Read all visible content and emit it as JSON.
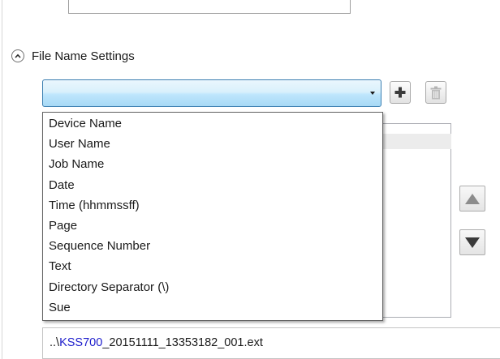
{
  "section": {
    "title": "File Name Settings",
    "toggle_icon": "chevron-up-icon"
  },
  "combo": {
    "selected_value": "",
    "arrow_icon": "triangle-down-icon"
  },
  "toolbar": {
    "add_icon": "plus-icon",
    "delete_icon": "trash-icon"
  },
  "dropdown": {
    "options": [
      "Device Name",
      "User Name",
      "Job Name",
      "Date",
      "Time (hhmmssff)",
      "Page",
      "Sequence Number",
      "Text",
      "Directory Separator (\\)",
      "Sue"
    ]
  },
  "reorder": {
    "up_icon": "triangle-up-icon",
    "down_icon": "triangle-down-icon"
  },
  "preview": {
    "prefix": "..\\",
    "highlight": "KSS700",
    "suffix": "_20151111_13353182_001.ext",
    "highlight_color": "#1d1dcc"
  },
  "colors": {
    "combo_border": "#3c7fb1",
    "combo_fill": "#bee6fd",
    "icon_dark": "#3a3a3a"
  }
}
